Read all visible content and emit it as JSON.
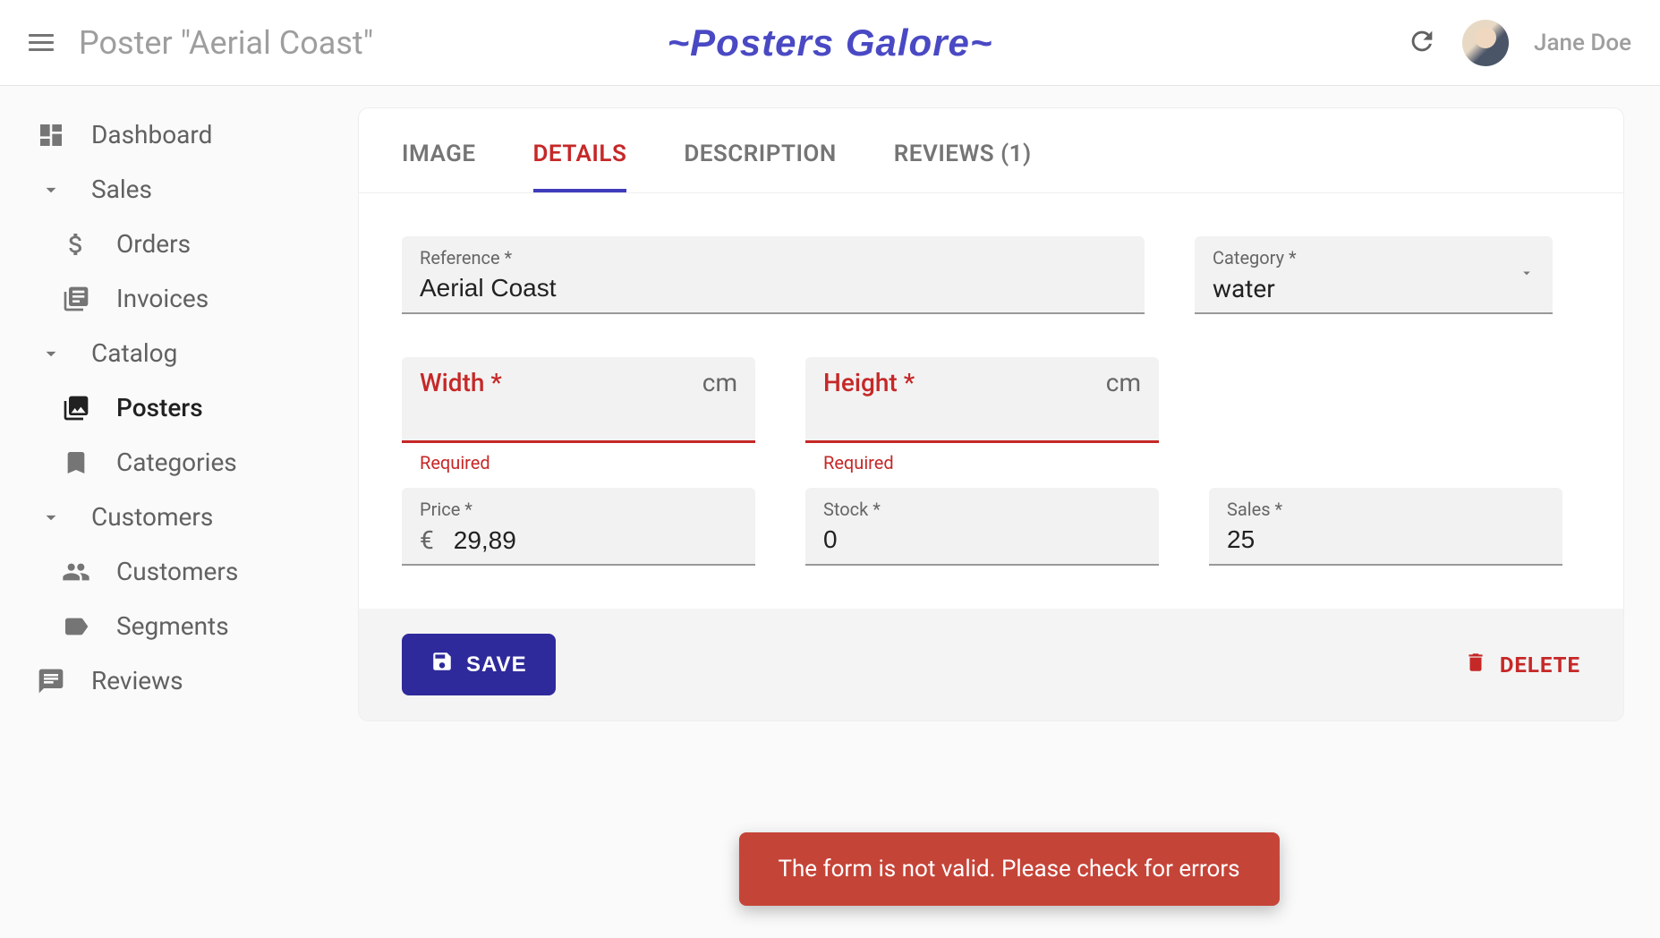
{
  "header": {
    "page_title": "Poster \"Aerial Coast\"",
    "brand": "~Posters Galore~",
    "username": "Jane Doe"
  },
  "sidebar": {
    "items": [
      {
        "label": "Dashboard",
        "icon": "dashboard",
        "type": "item"
      },
      {
        "label": "Sales",
        "icon": "chevron",
        "type": "group"
      },
      {
        "label": "Orders",
        "icon": "dollar",
        "type": "sub"
      },
      {
        "label": "Invoices",
        "icon": "invoice",
        "type": "sub"
      },
      {
        "label": "Catalog",
        "icon": "chevron",
        "type": "group"
      },
      {
        "label": "Posters",
        "icon": "image",
        "type": "sub",
        "active": true
      },
      {
        "label": "Categories",
        "icon": "bookmark",
        "type": "sub"
      },
      {
        "label": "Customers",
        "icon": "chevron",
        "type": "group"
      },
      {
        "label": "Customers",
        "icon": "people",
        "type": "sub"
      },
      {
        "label": "Segments",
        "icon": "tag",
        "type": "sub"
      },
      {
        "label": "Reviews",
        "icon": "comment",
        "type": "item"
      }
    ]
  },
  "tabs": [
    {
      "label": "IMAGE"
    },
    {
      "label": "DETAILS",
      "active": true
    },
    {
      "label": "DESCRIPTION"
    },
    {
      "label": "REVIEWS (1)"
    }
  ],
  "form": {
    "reference": {
      "label": "Reference *",
      "value": "Aerial Coast"
    },
    "category": {
      "label": "Category *",
      "value": "water"
    },
    "width": {
      "label": "Width *",
      "value": "",
      "suffix": "cm",
      "error": "Required"
    },
    "height": {
      "label": "Height *",
      "value": "",
      "suffix": "cm",
      "error": "Required"
    },
    "price": {
      "label": "Price *",
      "prefix": "€",
      "value": "29,89"
    },
    "stock": {
      "label": "Stock *",
      "value": "0"
    },
    "sales": {
      "label": "Sales *",
      "value": "25"
    }
  },
  "actions": {
    "save": "SAVE",
    "delete": "DELETE"
  },
  "snackbar": "The form is not valid. Please check for errors"
}
